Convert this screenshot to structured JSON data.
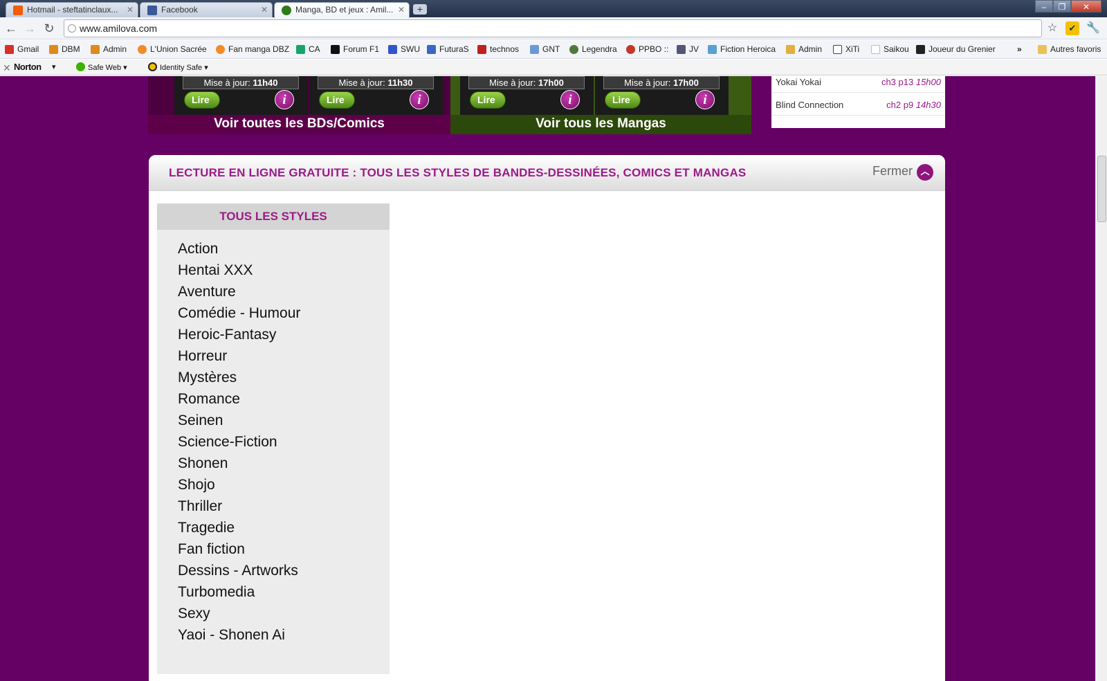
{
  "browser": {
    "tabs": [
      {
        "title": "Hotmail - steftatinclaux...",
        "favicon_color": "#f25c05"
      },
      {
        "title": "Facebook",
        "favicon_color": "#3b5998"
      },
      {
        "title": "Manga, BD et jeux : Amil...",
        "favicon_color": "#2f7a1a"
      }
    ],
    "new_tab": "+",
    "url": "www.amilova.com",
    "bookmarks": [
      {
        "label": "Gmail",
        "color": "#d93025"
      },
      {
        "label": "DBM",
        "color": "#e08a1e"
      },
      {
        "label": "Admin",
        "color": "#e08a1e"
      },
      {
        "label": "L'Union Sacrée",
        "color": "#f28c28"
      },
      {
        "label": "Fan manga DBZ",
        "color": "#f28c28"
      },
      {
        "label": "CA",
        "color": "#19a36a"
      },
      {
        "label": "Forum F1",
        "color": "#111111"
      },
      {
        "label": "SWU",
        "color": "#3355cc"
      },
      {
        "label": "FuturaS",
        "color": "#3a66c4"
      },
      {
        "label": "technos",
        "color": "#c02020"
      },
      {
        "label": "GNT",
        "color": "#6a9ad6"
      },
      {
        "label": "Legendra",
        "color": "#4d7a3a"
      },
      {
        "label": "PPBO ::",
        "color": "#c0392b"
      },
      {
        "label": "JV",
        "color": "#555577"
      },
      {
        "label": "Fiction Heroica",
        "color": "#5aa0d0"
      },
      {
        "label": "Admin",
        "color": "#e0b040"
      },
      {
        "label": "XiTi",
        "color": "#444444"
      },
      {
        "label": "Saikou",
        "color": "#bbbbbb"
      },
      {
        "label": "Joueur du Grenier",
        "color": "#222222"
      }
    ],
    "more_bookmarks": "»",
    "other_bookmarks": "Autres favoris",
    "norton": {
      "logo": "Norton",
      "safe_web": "Safe Web",
      "identity_safe": "Identity Safe"
    }
  },
  "promos": {
    "bd_link": "Voir toutes les BDs/Comics",
    "manga_link": "Voir tous les Mangas",
    "cards": [
      {
        "update_label": "Mise à jour:",
        "time": "11h40",
        "read": "Lire"
      },
      {
        "update_label": "Mise à jour:",
        "time": "11h30",
        "read": "Lire"
      },
      {
        "update_label": "Mise à jour:",
        "time": "17h00",
        "read": "Lire"
      },
      {
        "update_label": "Mise à jour:",
        "time": "17h00",
        "read": "Lire"
      }
    ],
    "info_glyph": "i"
  },
  "latest": [
    {
      "title": "Yokai Yokai",
      "chapter": "ch3 p13",
      "time": "15h00"
    },
    {
      "title": "Blind Connection",
      "chapter": "ch2 p9",
      "time": "14h30"
    }
  ],
  "panel": {
    "title": "LECTURE EN LIGNE GRATUITE : TOUS LES STYLES DE BANDES-DESSINÉES, COMICS ET MANGAS",
    "close_label": "Fermer",
    "styles_heading": "TOUS LES STYLES",
    "styles": [
      "Action",
      "Hentai XXX",
      "Aventure",
      "Comédie - Humour",
      "Heroic-Fantasy",
      "Horreur",
      "Mystères",
      "Romance",
      "Seinen",
      "Science-Fiction",
      "Shonen",
      "Shojo",
      "Thriller",
      "Tragedie",
      "Fan fiction",
      "Dessins - Artworks",
      "Turbomedia",
      "Sexy",
      "Yaoi - Shonen Ai"
    ]
  },
  "colors": {
    "page_background": "#650065",
    "accent": "#9c1a88",
    "bd_banner": "#5e0049",
    "manga_banner": "#2c480a"
  }
}
